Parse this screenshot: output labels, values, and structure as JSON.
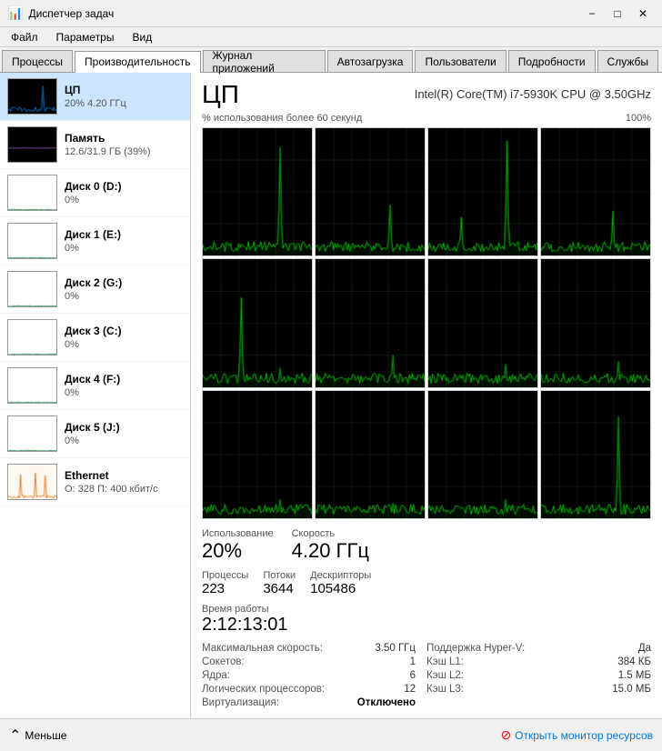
{
  "titleBar": {
    "title": "Диспетчер задач",
    "minimizeLabel": "−",
    "maximizeLabel": "□",
    "closeLabel": "✕"
  },
  "menuBar": {
    "items": [
      "Файл",
      "Параметры",
      "Вид"
    ]
  },
  "tabs": {
    "items": [
      "Процессы",
      "Производительность",
      "Журнал приложений",
      "Автозагрузка",
      "Пользователи",
      "Подробности",
      "Службы"
    ],
    "active": 1
  },
  "sidebar": {
    "items": [
      {
        "name": "ЦП",
        "value1": "20% 4.20 ГГц",
        "active": true,
        "color": "#0078d7"
      },
      {
        "name": "Память",
        "value1": "12.6/31.9 ГБ (39%)",
        "active": false,
        "color": "#9b59b6"
      },
      {
        "name": "Диск 0 (D:)",
        "value1": "0%",
        "active": false,
        "color": "#1e8449"
      },
      {
        "name": "Диск 1 (E:)",
        "value1": "0%",
        "active": false,
        "color": "#1e8449"
      },
      {
        "name": "Диск 2 (G:)",
        "value1": "0%",
        "active": false,
        "color": "#1e8449"
      },
      {
        "name": "Диск 3 (C:)",
        "value1": "0%",
        "active": false,
        "color": "#1e8449"
      },
      {
        "name": "Диск 4 (F:)",
        "value1": "0%",
        "active": false,
        "color": "#1e8449"
      },
      {
        "name": "Диск 5 (J:)",
        "value1": "0%",
        "active": false,
        "color": "#1e8449"
      },
      {
        "name": "Ethernet",
        "value1": "О: 328 П: 400 кбит/с",
        "active": false,
        "color": "#e67e22",
        "isEthernet": true
      }
    ]
  },
  "rightPanel": {
    "title": "ЦП",
    "subtitle": "Intel(R) Core(TM) i7-5930K CPU @ 3.50GHz",
    "usageLabel": "% использования более 60 секунд",
    "usagePercent": "100%",
    "stats": {
      "usageLabel": "Использование",
      "usageValue": "20%",
      "speedLabel": "Скорость",
      "speedValue": "4.20 ГГц"
    },
    "smallStats": {
      "processesLabel": "Процессы",
      "processesValue": "223",
      "threadsLabel": "Потоки",
      "threadsValue": "3644",
      "descriptorsLabel": "Дескрипторы",
      "descriptorsValue": "105486"
    },
    "uptime": {
      "label": "Время работы",
      "value": "2:12:13:01"
    },
    "info": {
      "left": [
        {
          "key": "Максимальная скорость:",
          "value": "3.50 ГГц"
        },
        {
          "key": "Сокетов:",
          "value": "1"
        },
        {
          "key": "Ядра:",
          "value": "6"
        },
        {
          "key": "Логических процессоров:",
          "value": "12"
        },
        {
          "key": "Виртуализация:",
          "value": "Отключено",
          "bold": true
        }
      ],
      "right": [
        {
          "key": "Поддержка Hyper-V:",
          "value": "Да"
        },
        {
          "key": "Кэш L1:",
          "value": "384 КБ"
        },
        {
          "key": "Кэш L2:",
          "value": "1.5 МБ"
        },
        {
          "key": "Кэш L3:",
          "value": "15.0 МБ"
        }
      ]
    }
  },
  "bottomBar": {
    "lessLabel": "Меньше",
    "monitorLabel": "Открыть монитор ресурсов"
  }
}
